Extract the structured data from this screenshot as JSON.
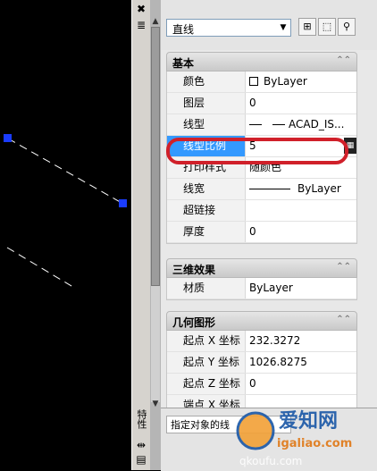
{
  "object_selector": {
    "value": "直线"
  },
  "icons": {
    "quick_select": "quick-select-icon",
    "select_objects": "select-objects-icon",
    "pickadd": "pickadd-icon"
  },
  "sections": {
    "basic": {
      "title": "基本",
      "rows": [
        {
          "name": "颜色",
          "value": "ByLayer"
        },
        {
          "name": "图层",
          "value": "0"
        },
        {
          "name": "线型",
          "value": "ACAD_IS..."
        },
        {
          "name": "线型比例",
          "value": "5"
        },
        {
          "name": "打印样式",
          "value": "随颜色"
        },
        {
          "name": "线宽",
          "value": "ByLayer"
        },
        {
          "name": "超链接",
          "value": ""
        },
        {
          "name": "厚度",
          "value": "0"
        }
      ]
    },
    "3d": {
      "title": "三维效果",
      "rows": [
        {
          "name": "材质",
          "value": "ByLayer"
        }
      ]
    },
    "geometry": {
      "title": "几何图形",
      "rows": [
        {
          "name": "起点 X 坐标",
          "value": "232.3272"
        },
        {
          "name": "起点 Y 坐标",
          "value": "1026.8275"
        },
        {
          "name": "起点 Z 坐标",
          "value": "0"
        },
        {
          "name": "端点 X 坐标",
          "value": ""
        }
      ]
    }
  },
  "bottom_hint": "指定对象的线",
  "side_strip": {
    "vertical_label": "特性"
  },
  "watermark": {
    "line1": "爱知网",
    "line2": "igaliao.com",
    "line3": "qkoufu.com"
  },
  "colors": {
    "selection": "#3399ff",
    "highlight_ring": "#d0202a",
    "grip": "#1a3cff"
  }
}
